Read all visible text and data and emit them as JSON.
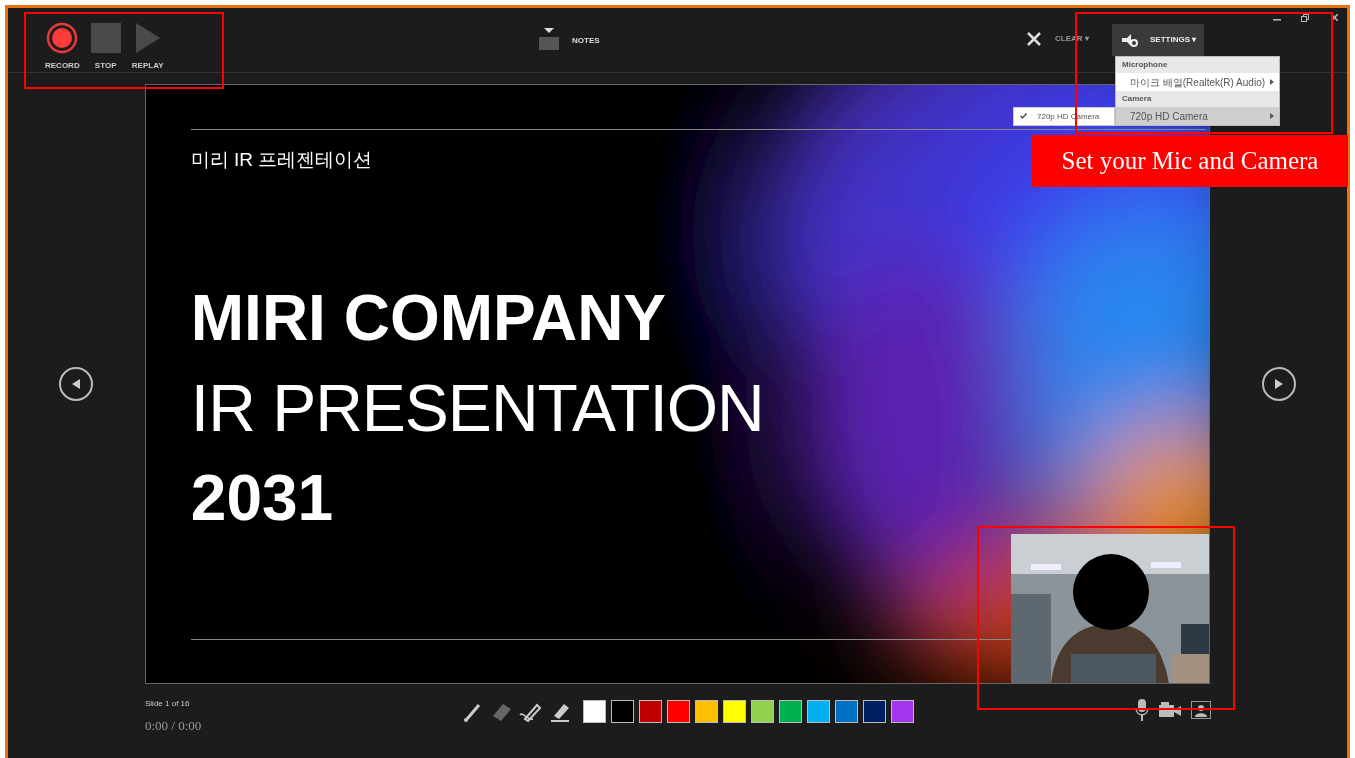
{
  "toolbar": {
    "record_controls": [
      {
        "kind": "record",
        "label": "RECORD"
      },
      {
        "kind": "stop",
        "label": "STOP"
      },
      {
        "kind": "replay",
        "label": "REPLAY"
      }
    ],
    "notes_button": {
      "label": "NOTES"
    },
    "clear_button": {
      "label": "CLEAR ▾"
    },
    "settings_button": {
      "label": "SETTINGS ▾"
    }
  },
  "settings_menu": {
    "sections": [
      {
        "header": "Microphone",
        "items": [
          {
            "label": "마이크 배열(Realtek(R) Audio)",
            "selected": false
          }
        ]
      },
      {
        "header": "Camera",
        "items": [
          {
            "label": "720p HD Camera",
            "selected": true
          }
        ]
      }
    ]
  },
  "camera_submenu": {
    "items": [
      {
        "label": "720p HD Camera",
        "checked": true
      }
    ]
  },
  "slide": {
    "subtitle": "미리 IR 프레젠테이션",
    "title_lines": [
      {
        "kind": "bold",
        "text": "MIRI COMPANY"
      },
      {
        "kind": "light",
        "text": "IR PRESENTATION"
      },
      {
        "kind": "bold",
        "text": "2031"
      }
    ]
  },
  "slide_counter": "Slide 1 of 16",
  "time": "0:00 / 0:00",
  "pen_colors": [
    {
      "color": "#ffffff"
    },
    {
      "color": "#000000"
    },
    {
      "color": "#c00000"
    },
    {
      "color": "#ff0000"
    },
    {
      "color": "#ffc000"
    },
    {
      "color": "#ffff00"
    },
    {
      "color": "#92d050"
    },
    {
      "color": "#00b050"
    },
    {
      "color": "#00b0f0"
    },
    {
      "color": "#0070c0"
    },
    {
      "color": "#002060"
    },
    {
      "color": "#a335ee"
    }
  ],
  "annotation": {
    "callout": "Set your Mic and Camera"
  }
}
